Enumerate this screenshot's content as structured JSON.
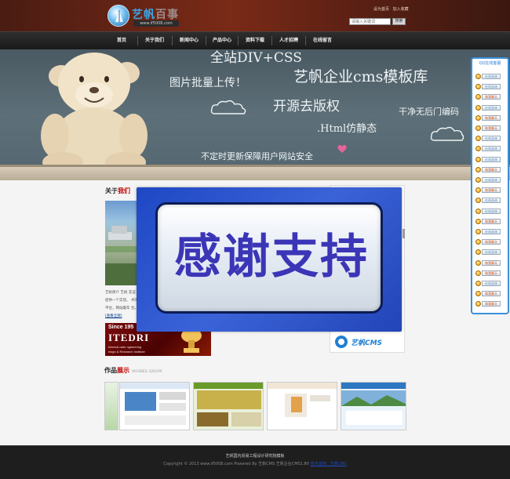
{
  "brand": {
    "name_lead": "艺帆",
    "name_tail": "百事",
    "url": "www.if5008.com"
  },
  "header": {
    "links": [
      "设为首页",
      "加入收藏"
    ],
    "search_placeholder": "请输入关键词",
    "search_button": "搜索"
  },
  "nav": {
    "items": [
      "首页",
      "关于我们",
      "新闻中心",
      "产品中心",
      "资料下载",
      "人才招聘",
      "在线留言"
    ]
  },
  "banner": {
    "lines": [
      "全站DIV+CSS",
      "图片批量上传！",
      "艺帆企业cms模板库",
      "开源去版权",
      "干净无后门编码",
      ".Html仿静态",
      "不定时更新保障用户网站安全"
    ]
  },
  "about": {
    "title_black": "关于",
    "title_red": "我们",
    "text": "艺帆简介   艺帆 友谊提供一个实现。 术的平台，网站最年 合。",
    "more": "[查看全部]"
  },
  "ad": {
    "since": "Since 195",
    "brand": "ITEDRI",
    "sub1": "Internal  rade  ngineering",
    "sub2": "esign & Research Institute"
  },
  "works": {
    "title_black": "作品",
    "title_red": "展示",
    "en": "WORKS SHOW"
  },
  "popup": {
    "text": "感谢支持"
  },
  "cms_logo": {
    "text": "艺帆CMS"
  },
  "qq": {
    "title": "QQ在线客服",
    "items": [
      {
        "label": "在线咨询",
        "color": "#5c89ba"
      },
      {
        "label": "在线咨询",
        "color": "#5c89ba"
      },
      {
        "label": "和我聊天",
        "color": "#cc4b14"
      },
      {
        "label": "在线咨询",
        "color": "#5c89ba"
      },
      {
        "label": "和我聊天",
        "color": "#cc4b14"
      },
      {
        "label": "和我聊天",
        "color": "#cc4b14"
      },
      {
        "label": "在线咨询",
        "color": "#5c89ba"
      },
      {
        "label": "在线咨询",
        "color": "#5c89ba"
      },
      {
        "label": "在线咨询",
        "color": "#5c89ba"
      },
      {
        "label": "和我聊天",
        "color": "#cc4b14"
      },
      {
        "label": "在线咨询",
        "color": "#5c89ba"
      },
      {
        "label": "和我聊天",
        "color": "#cc4b14"
      },
      {
        "label": "在线咨询",
        "color": "#5c89ba"
      },
      {
        "label": "在线咨询",
        "color": "#5c89ba"
      },
      {
        "label": "和我聊天",
        "color": "#cc4b14"
      },
      {
        "label": "在线咨询",
        "color": "#5c89ba"
      },
      {
        "label": "和我聊天",
        "color": "#cc4b14"
      },
      {
        "label": "在线咨询",
        "color": "#5c89ba"
      },
      {
        "label": "和我聊天",
        "color": "#cc4b14"
      },
      {
        "label": "和我聊天",
        "color": "#cc4b14"
      },
      {
        "label": "在线咨询",
        "color": "#5c89ba"
      },
      {
        "label": "和我聊天",
        "color": "#cc4b14"
      },
      {
        "label": "和我聊天",
        "color": "#cc4b14"
      }
    ]
  },
  "footer": {
    "line1": "艺帆国内贸易工程设计研究院模板",
    "line2": "Copyright © 2013 www.if5008.com Powered By 艺帆CMS 艺帆企业CMS1.8V",
    "link": "技术支持：艺帆CMS"
  }
}
